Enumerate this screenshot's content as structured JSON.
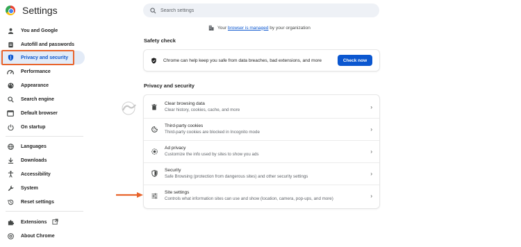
{
  "header": {
    "title": "Settings"
  },
  "search": {
    "placeholder": "Search settings"
  },
  "sidebar": {
    "items": [
      {
        "label": "You and Google",
        "icon": "person-icon"
      },
      {
        "label": "Autofill and passwords",
        "icon": "clipboard-icon"
      },
      {
        "label": "Privacy and security",
        "icon": "shield-icon",
        "active": true
      },
      {
        "label": "Performance",
        "icon": "speedometer-icon"
      },
      {
        "label": "Appearance",
        "icon": "palette-icon"
      },
      {
        "label": "Search engine",
        "icon": "search-icon"
      },
      {
        "label": "Default browser",
        "icon": "browser-icon"
      },
      {
        "label": "On startup",
        "icon": "power-icon"
      },
      {
        "label": "Languages",
        "icon": "globe-icon"
      },
      {
        "label": "Downloads",
        "icon": "download-icon"
      },
      {
        "label": "Accessibility",
        "icon": "accessibility-icon"
      },
      {
        "label": "System",
        "icon": "wrench-icon"
      },
      {
        "label": "Reset settings",
        "icon": "history-icon"
      },
      {
        "label": "Extensions",
        "icon": "puzzle-icon"
      },
      {
        "label": "About Chrome",
        "icon": "chrome-icon"
      }
    ]
  },
  "managed": {
    "prefix": "Your",
    "link": "browser is managed",
    "suffix": "by your organization"
  },
  "safety_check": {
    "title": "Safety check",
    "text": "Chrome can help keep you safe from data breaches, bad extensions, and more",
    "button": "Check now"
  },
  "privacy": {
    "title": "Privacy and security",
    "rows": [
      {
        "title": "Clear browsing data",
        "subtitle": "Clear history, cookies, cache, and more",
        "icon": "trash-icon"
      },
      {
        "title": "Third-party cookies",
        "subtitle": "Third-party cookies are blocked in Incognito mode",
        "icon": "cookie-icon"
      },
      {
        "title": "Ad privacy",
        "subtitle": "Customize the info used by sites to show you ads",
        "icon": "ad-privacy-icon"
      },
      {
        "title": "Security",
        "subtitle": "Safe Browsing (protection from dangerous sites) and other security settings",
        "icon": "shield-icon"
      },
      {
        "title": "Site settings",
        "subtitle": "Controls what information sites can use and show (location, camera, pop-ups, and more)",
        "icon": "sliders-icon"
      }
    ]
  },
  "colors": {
    "accent": "#0b57d0",
    "highlight": "#e8632b",
    "active_bg": "#e3ebf7"
  }
}
